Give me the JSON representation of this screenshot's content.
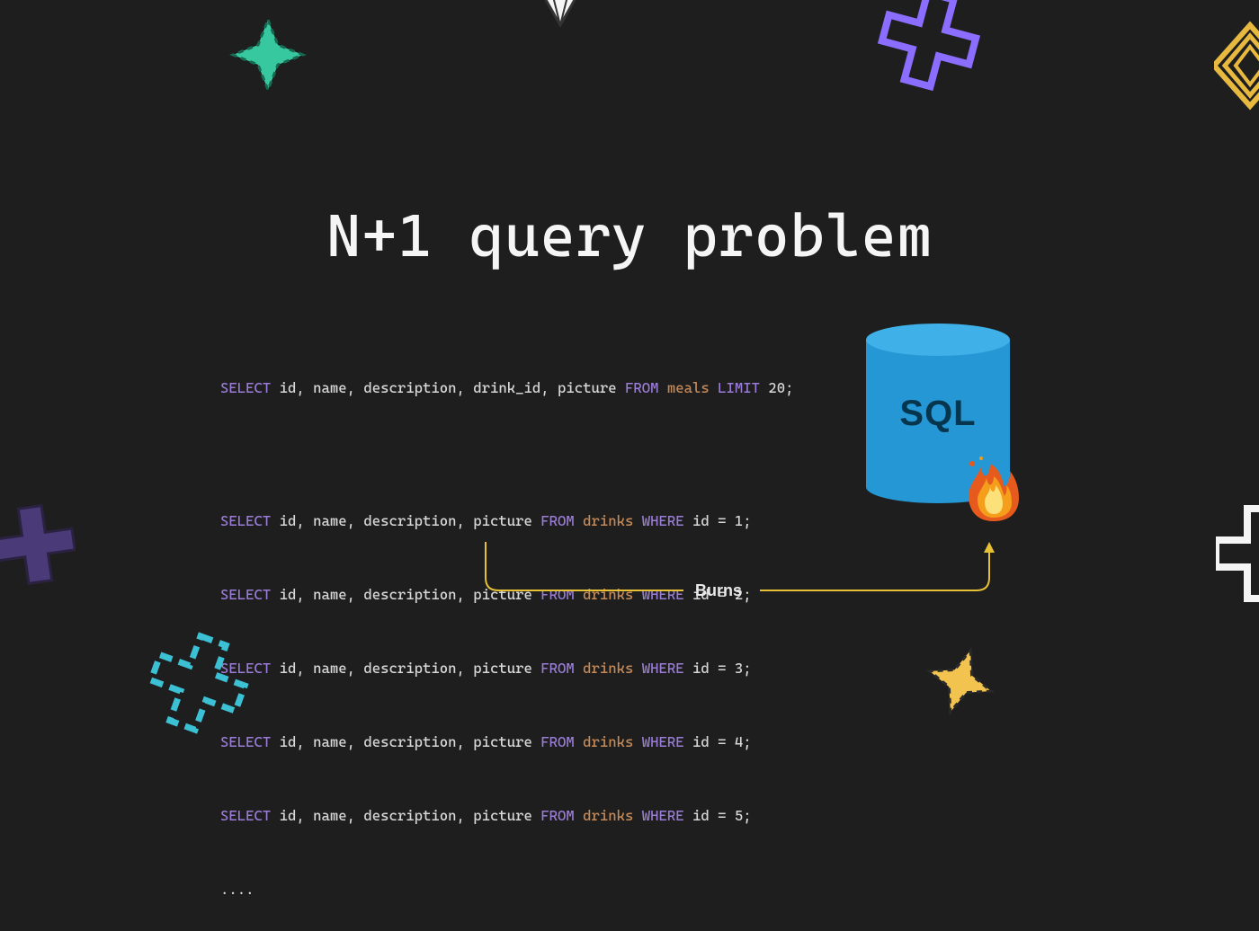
{
  "title": "N+1 query problem",
  "colors": {
    "background": "#1e1e1e",
    "text": "#f5f5f5",
    "keyword": "#9b7dd8",
    "table": "#c48a5a",
    "default": "#d8d8d8",
    "db_body": "#2597d4",
    "db_top": "#3fb0e8",
    "arrow": "#e6c136",
    "star_teal": "#37c8a0",
    "plus_purple": "#8b6dff",
    "plus_darkpurple": "#4a3a78",
    "plus_cyan": "#3bc0d4",
    "star_yellow": "#f2c34e",
    "diamond_yellow": "#e8b93f"
  },
  "db": {
    "label": "SQL"
  },
  "connector": {
    "label": "Burns"
  },
  "queries": {
    "initial": {
      "select": "SELECT",
      "cols": "id, name, description, drink_id, picture",
      "from": "FROM",
      "table": "meals",
      "limit_kw": "LIMIT",
      "limit_val": "20"
    },
    "repeats": [
      {
        "select": "SELECT",
        "cols": "id, name, description, picture",
        "from": "FROM",
        "table": "drinks",
        "where": "WHERE",
        "cond": "id = 1"
      },
      {
        "select": "SELECT",
        "cols": "id, name, description, picture",
        "from": "FROM",
        "table": "drinks",
        "where": "WHERE",
        "cond": "id = 2"
      },
      {
        "select": "SELECT",
        "cols": "id, name, description, picture",
        "from": "FROM",
        "table": "drinks",
        "where": "WHERE",
        "cond": "id = 3"
      },
      {
        "select": "SELECT",
        "cols": "id, name, description, picture",
        "from": "FROM",
        "table": "drinks",
        "where": "WHERE",
        "cond": "id = 4"
      },
      {
        "select": "SELECT",
        "cols": "id, name, description, picture",
        "from": "FROM",
        "table": "drinks",
        "where": "WHERE",
        "cond": "id = 5"
      }
    ],
    "ellipsis": "...."
  }
}
